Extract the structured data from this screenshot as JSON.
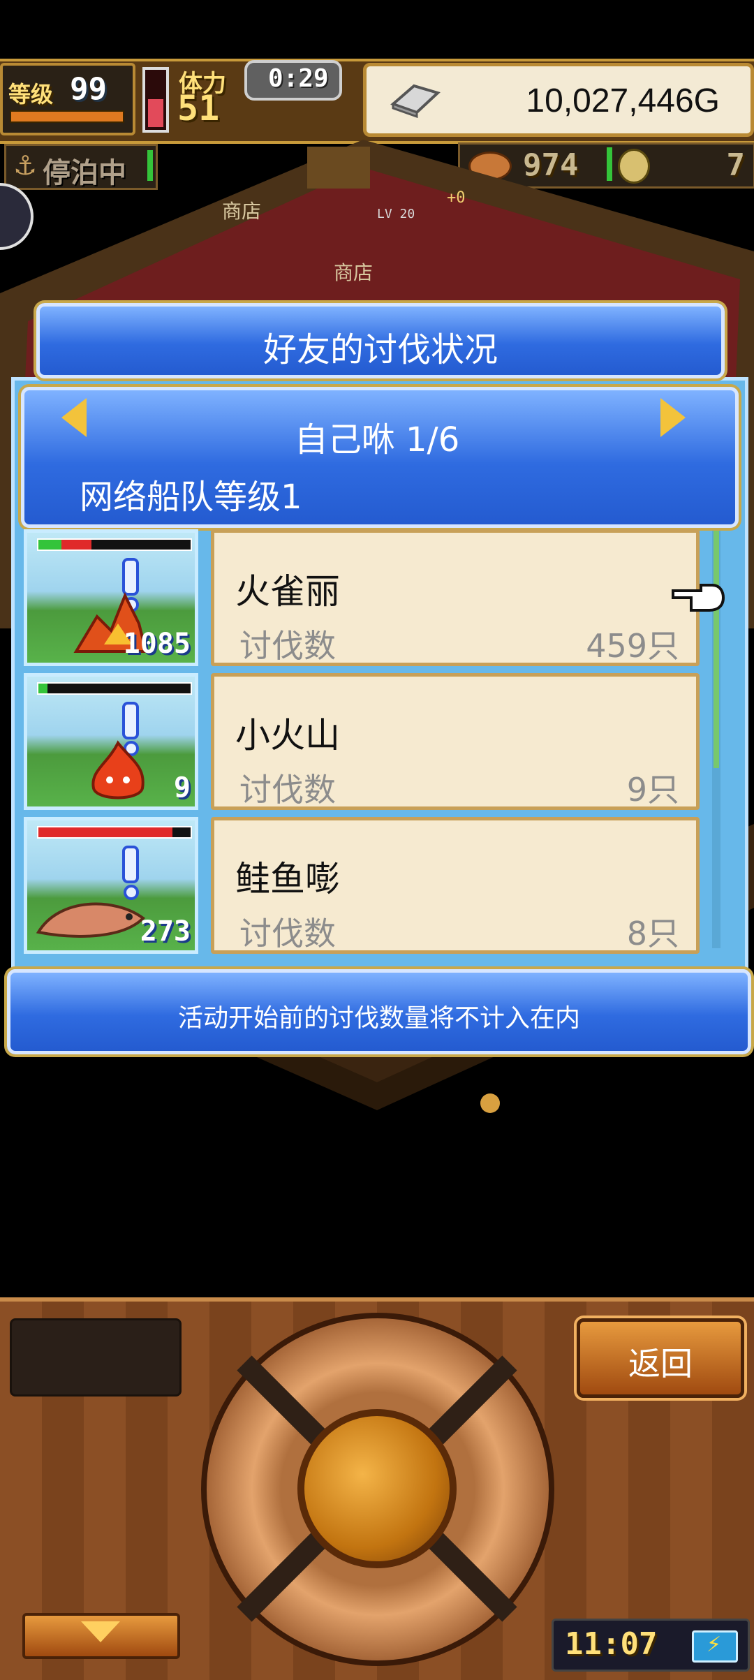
{
  "hud": {
    "level_label": "等级",
    "level_value": "99",
    "stamina_label": "体力",
    "stamina_value": "51",
    "timer": "0:29",
    "gold": "10,027,446G",
    "status": "停泊中",
    "resource_count": "974",
    "coin_count": "7"
  },
  "scene": {
    "shop_sign_1": "商店",
    "shop_sign_2": "商店",
    "npc_level": "LV 20",
    "npc_plus": "+0"
  },
  "dialog": {
    "title": "好友的讨伐状况",
    "page_label": "自己咻 1/6",
    "fleet_label": "网络船队等级1",
    "notice": "活动开始前的讨伐数量将不计入在内",
    "rows": [
      {
        "name": "火雀丽",
        "kill_label": "讨伐数",
        "kill_value": "459只",
        "thumb_count": "1085",
        "monster_icon": "fire-bird-icon",
        "hp_green": 0.15,
        "hp_red": 0.2
      },
      {
        "name": "小火山",
        "kill_label": "讨伐数",
        "kill_value": "9只",
        "thumb_count": "9",
        "monster_icon": "fire-spirit-icon",
        "hp_green": 0.06,
        "hp_red": 0.0
      },
      {
        "name": "鲑鱼嘭",
        "kill_label": "讨伐数",
        "kill_value": "8只",
        "thumb_count": "273",
        "monster_icon": "salmon-icon",
        "hp_green": 0.0,
        "hp_red": 0.88
      }
    ]
  },
  "controller": {
    "back_label": "返回",
    "clock": "11:07"
  },
  "colors": {
    "panel_blue": "#2f6be0",
    "info_bg": "#f6ead0",
    "accent_gold": "#f3c33b"
  }
}
